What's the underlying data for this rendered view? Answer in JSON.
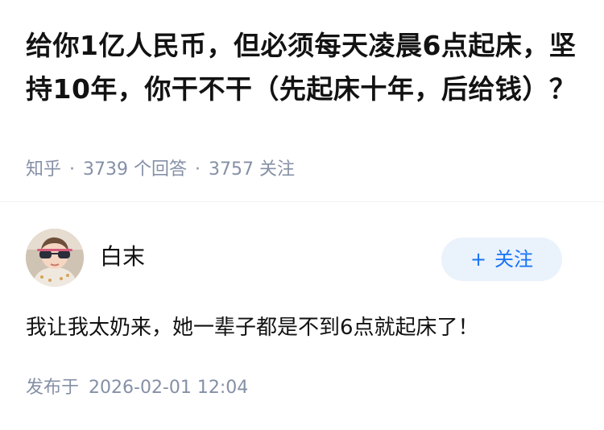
{
  "question": {
    "title": "给你1亿人民币，但必须每天凌晨6点起床，坚持10年，你干不干（先起床十年，后给钱）？",
    "source": "知乎",
    "answer_count": "3739",
    "answer_label": "个回答",
    "follower_count": "3757",
    "follower_label": "关注",
    "separator": "·"
  },
  "answer": {
    "author_name": "白末",
    "follow_button": {
      "icon": "+",
      "label": "关注"
    },
    "content": "我让我太奶来，她一辈子都是不到6点就起床了！",
    "publish_label": "发布于",
    "publish_time": "2026-02-01 12:04"
  },
  "colors": {
    "text_primary": "#121212",
    "text_secondary": "#8590a6",
    "accent": "#1772f6",
    "accent_bg": "#eaf2fc"
  }
}
